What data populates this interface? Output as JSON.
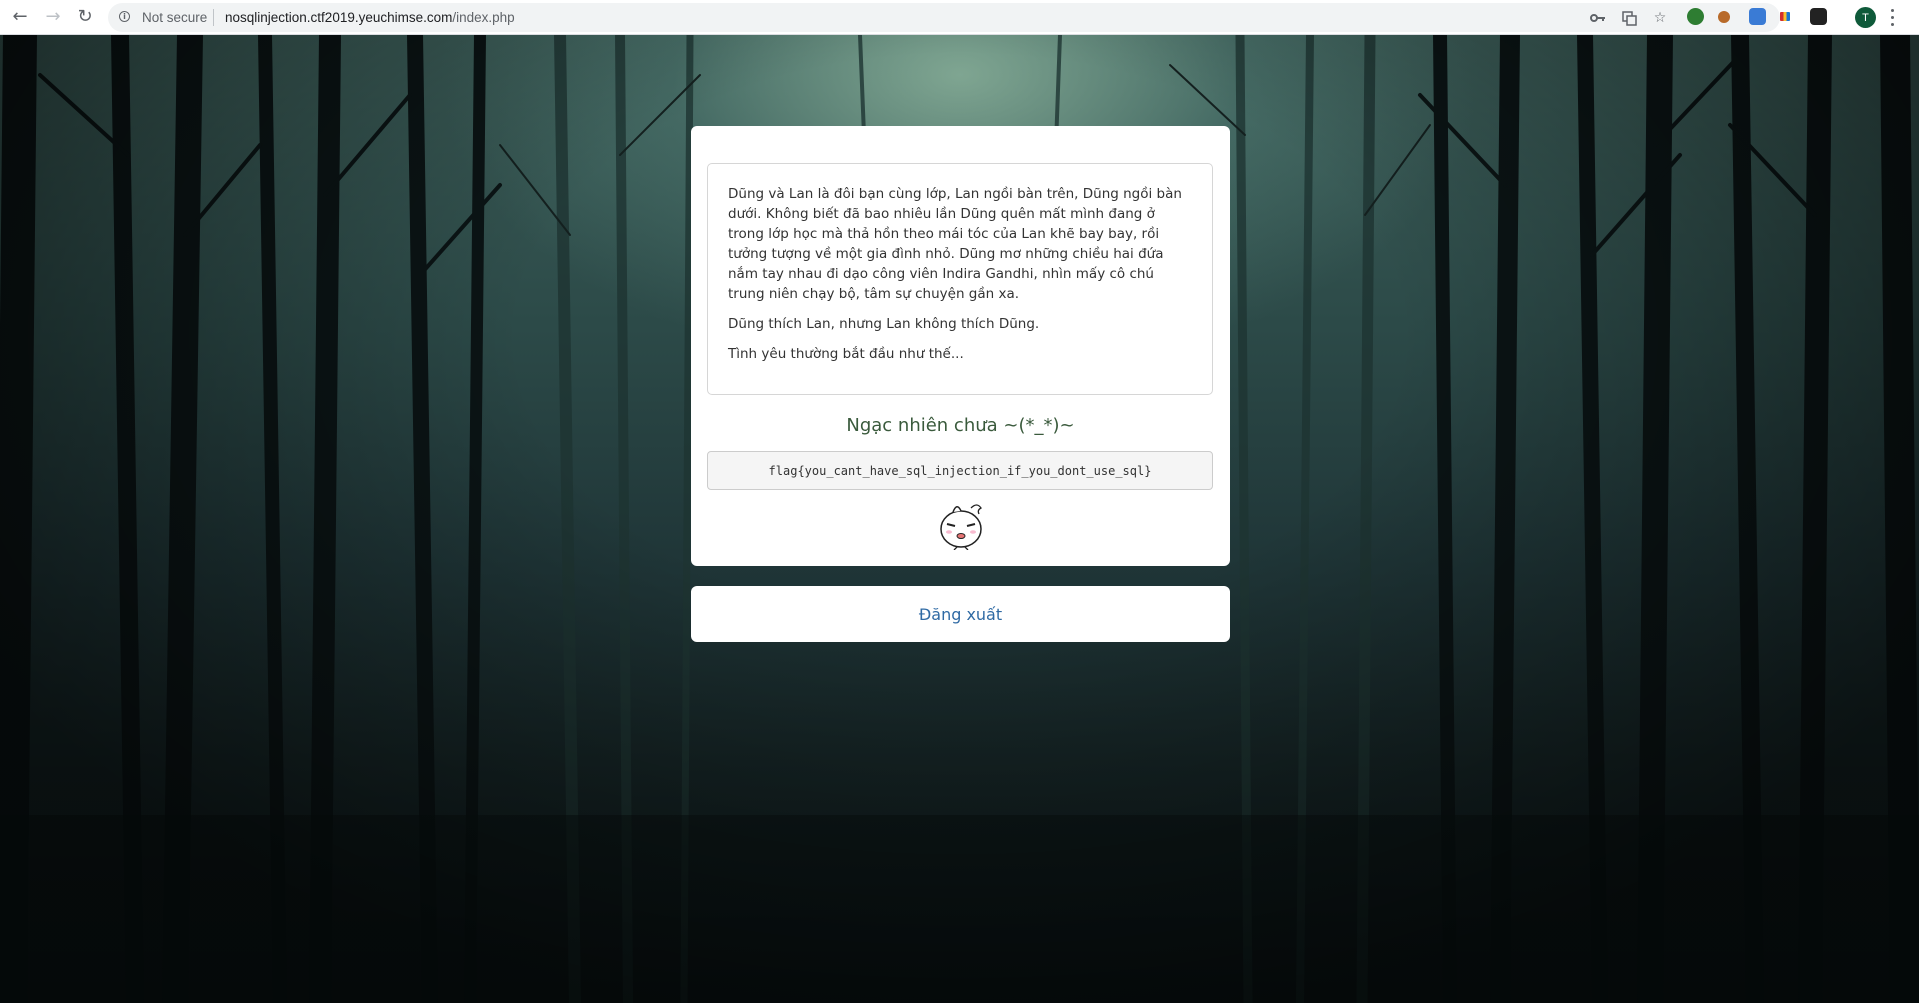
{
  "browser": {
    "not_secure_label": "Not secure",
    "url_host": "nosqlinjection.ctf2019.yeuchimse.com",
    "url_path": "/index.php",
    "profile_initial": "T"
  },
  "content": {
    "paragraphs": [
      "Dũng và Lan là đôi bạn cùng lớp, Lan ngồi bàn trên, Dũng ngồi bàn dưới. Không biết đã bao nhiêu lần Dũng quên mất mình đang ở trong lớp học mà thả hồn theo mái tóc của Lan khẽ bay bay, rồi tưởng tượng về một gia đình nhỏ. Dũng mơ những chiều hai đứa nắm tay nhau đi dạo công viên Indira Gandhi, nhìn mấy cô chú trung niên chạy bộ, tâm sự chuyện gần xa.",
      "Dũng thích Lan, nhưng Lan không thích Dũng.",
      "Tình yêu thường bắt đầu như thế..."
    ],
    "subtitle": "Ngạc nhiên chưa ~(*_*)~",
    "flag": "flag{you_cant_have_sql_injection_if_you_dont_use_sql}",
    "logout_label": "Đăng xuất"
  },
  "icons": {
    "info": "info-icon",
    "key": "key-icon",
    "translate": "translate-icon",
    "star": "star-icon",
    "sticker": "onion-head-sticker-icon"
  },
  "colors": {
    "subtitle": "#3a5a3c",
    "logout_link": "#2f6aa4",
    "profile": "#0f5a3a"
  }
}
